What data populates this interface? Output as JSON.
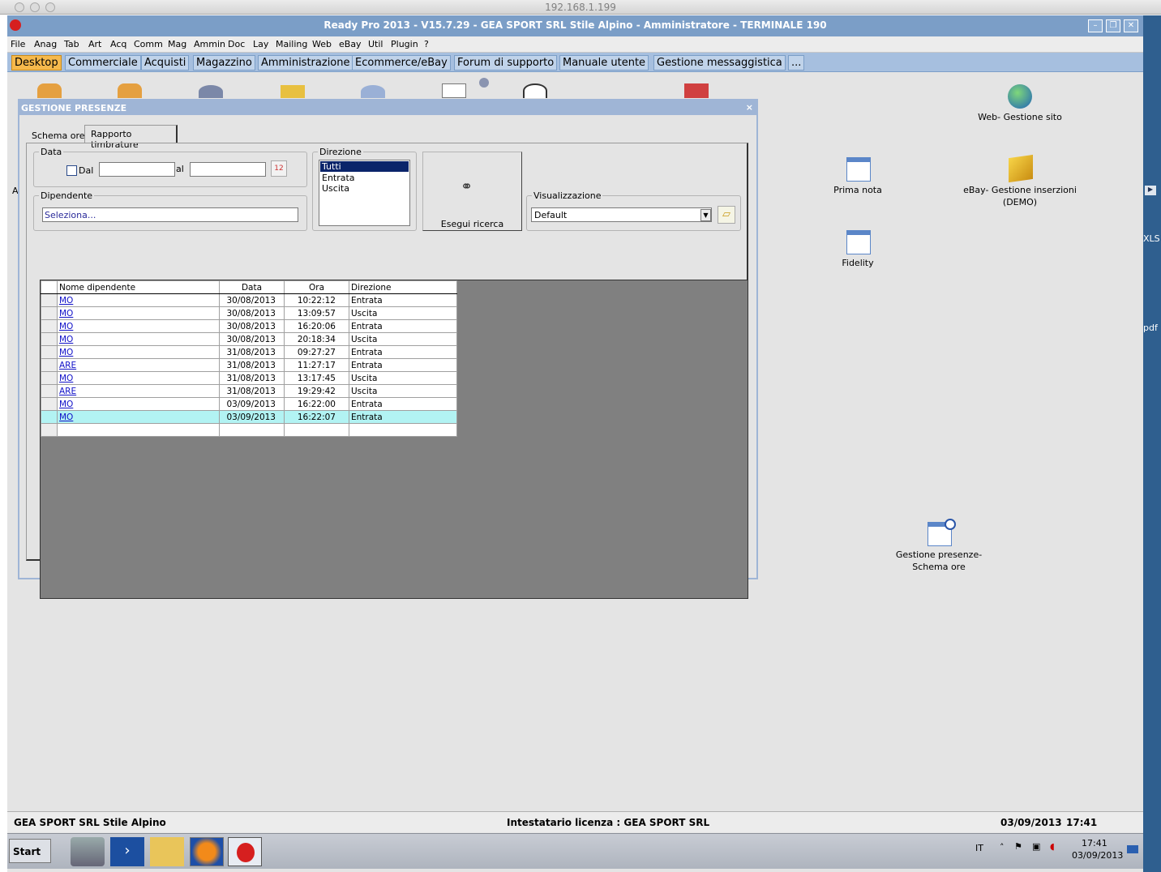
{
  "mac": {
    "title": "192.168.1.199"
  },
  "app": {
    "title": "Ready Pro 2013 - V15.7.29 - GEA SPORT SRL Stile Alpino - Amministratore - TERMINALE 190"
  },
  "menu": [
    "File",
    "Anag",
    "Tab",
    "Art",
    "Acq",
    "Comm",
    "Mag",
    "Ammin",
    "Doc",
    "Lay",
    "Mailing",
    "Web",
    "eBay",
    "Util",
    "Plugin",
    "?"
  ],
  "tabs": [
    "Desktop",
    "Commerciale",
    "Acquisti",
    "Magazzino",
    "Amministrazione",
    "Ecommerce/eBay",
    "Forum di supporto",
    "Manuale utente",
    "Gestione messaggistica",
    "..."
  ],
  "desktop_icons": [
    {
      "label": "Web- Gestione sito",
      "icon": "globe-icon"
    },
    {
      "label": "Prima nota",
      "icon": "calendar-icon"
    },
    {
      "label": "eBay- Gestione inserzioni (DEMO)",
      "icon": "cube-icon"
    },
    {
      "label": "Fidelity",
      "icon": "calendar-icon"
    },
    {
      "label": "Gestione presenze- Schema ore",
      "icon": "clock-calendar-icon"
    }
  ],
  "right_edge": [
    "XLS",
    "pdf"
  ],
  "dialog": {
    "title": "GESTIONE PRESENZE",
    "close": "×",
    "subtabs": [
      "Schema ore",
      "Rapporto timbrature"
    ],
    "data_legend": "Data",
    "dal_label": "Dal",
    "al_label": "al",
    "dipendente_legend": "Dipendente",
    "dipendente_value": "Seleziona...",
    "direzione_legend": "Direzione",
    "direzione_options": [
      "Tutti",
      "Entrata",
      "Uscita"
    ],
    "search_label": "Esegui ricerca",
    "visualizzazione_legend": "Visualizzazione",
    "visualizzazione_value": "Default",
    "columns": [
      "Nome dipendente",
      "Data",
      "Ora",
      "Direzione"
    ],
    "rows": [
      [
        "MO",
        "30/08/2013",
        "10:22:12",
        "Entrata"
      ],
      [
        "MO",
        "30/08/2013",
        "13:09:57",
        "Uscita"
      ],
      [
        "MO",
        "30/08/2013",
        "16:20:06",
        "Entrata"
      ],
      [
        "MO",
        "30/08/2013",
        "20:18:34",
        "Uscita"
      ],
      [
        "MO",
        "31/08/2013",
        "09:27:27",
        "Entrata"
      ],
      [
        "ARE",
        "31/08/2013",
        "11:27:17",
        "Entrata"
      ],
      [
        "MO",
        "31/08/2013",
        "13:17:45",
        "Uscita"
      ],
      [
        "ARE",
        "31/08/2013",
        "19:29:42",
        "Uscita"
      ],
      [
        "MO",
        "03/09/2013",
        "16:22:00",
        "Entrata"
      ],
      [
        "MO",
        "03/09/2013",
        "16:22:07",
        "Entrata"
      ]
    ]
  },
  "status": {
    "company": "GEA SPORT SRL Stile Alpino",
    "license": "Intestatario licenza : GEA SPORT SRL",
    "date": "03/09/2013",
    "time": "17:41"
  },
  "taskbar": {
    "start": "Start",
    "lang": "IT",
    "clock_time": "17:41",
    "clock_date": "03/09/2013"
  },
  "colors": {
    "title_bar": "#7b9ec7",
    "tab_active": "#f6b94c",
    "selected_row": "#b2f3f3"
  }
}
